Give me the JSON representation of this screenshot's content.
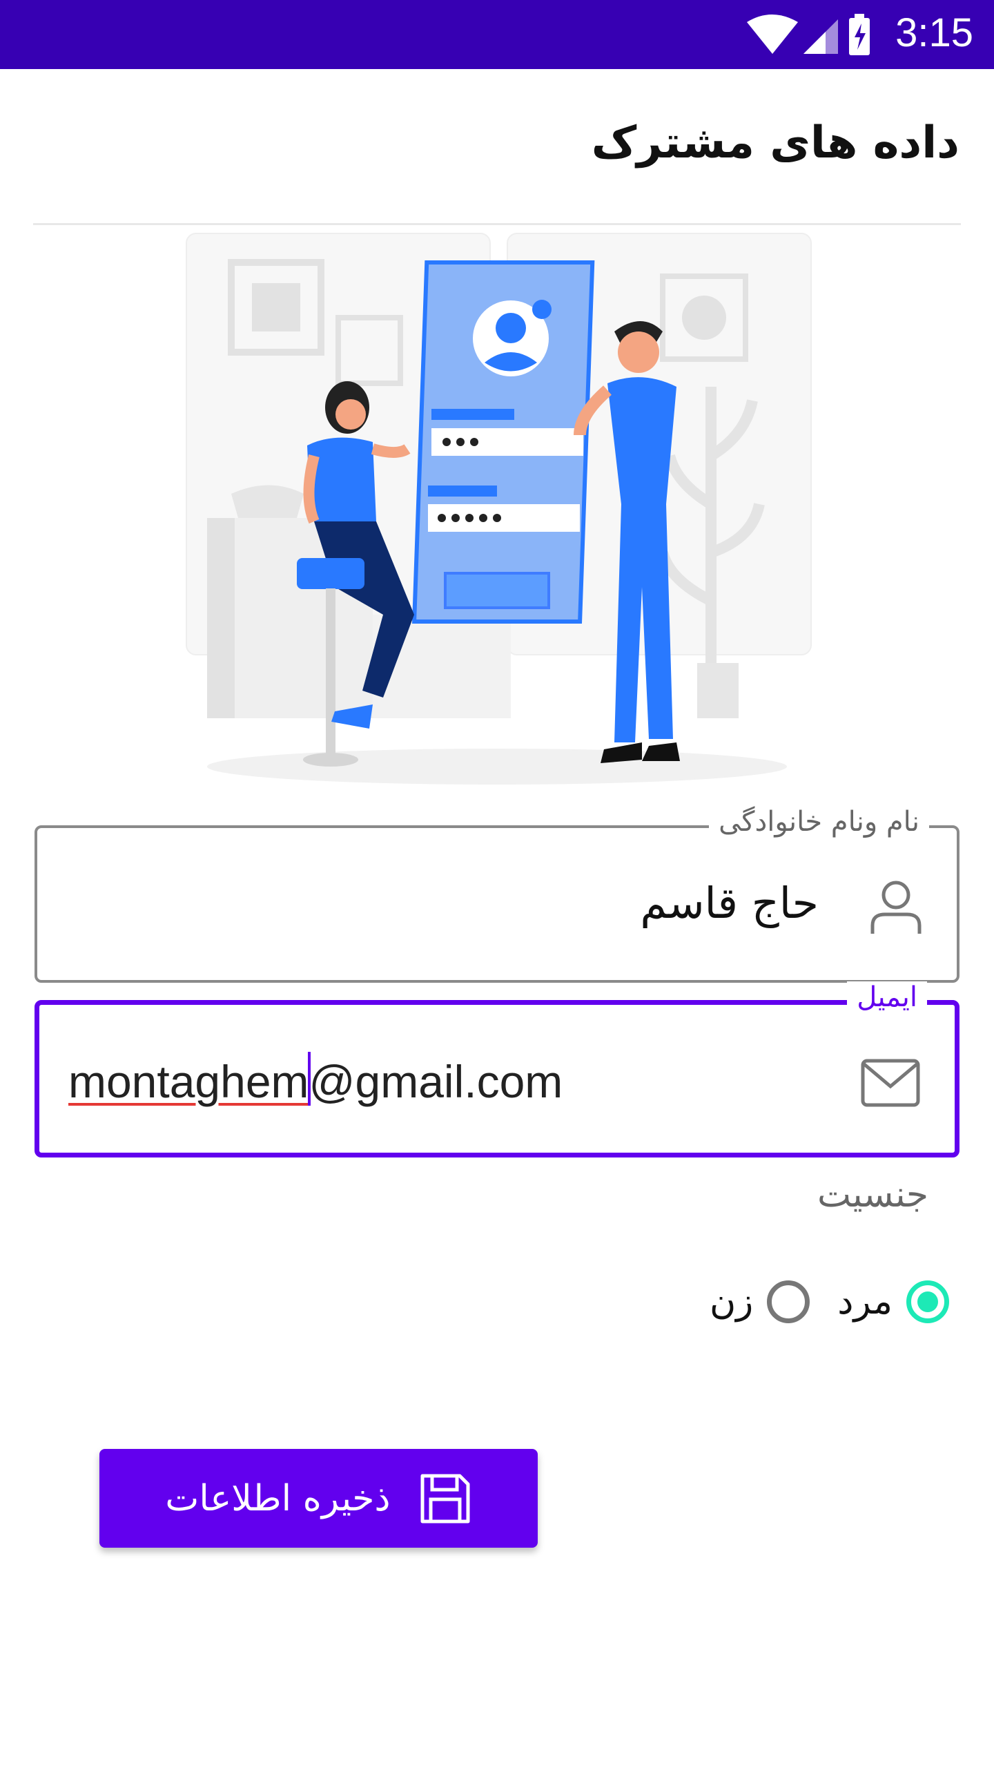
{
  "status_bar": {
    "time": "3:15",
    "icons": [
      "wifi-icon",
      "signal-icon",
      "battery-charging-icon"
    ],
    "color": "#3700b3"
  },
  "header": {
    "title": "داده های مشترک"
  },
  "form": {
    "name_field": {
      "label": "نام ونام خانوادگی",
      "value": "حاج قاسم",
      "icon": "person-icon"
    },
    "email_field": {
      "label": "ایمیل",
      "value_local": "montaghem",
      "value_domain": "@gmail.com",
      "icon": "mail-icon",
      "accent": "#6200ee"
    },
    "gender": {
      "label": "جنسیت",
      "options": [
        {
          "label": "مرد",
          "selected": true
        },
        {
          "label": "زن",
          "selected": false
        }
      ]
    },
    "save_button": {
      "label": "ذخیره اطلاعات",
      "icon": "save-icon",
      "color": "#6200ee"
    }
  },
  "colors": {
    "primary": "#6200ee",
    "status_bar": "#3700b3",
    "radio_selected": "#1de9b6"
  }
}
